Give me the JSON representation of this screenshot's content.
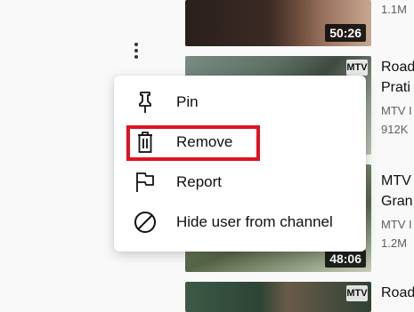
{
  "videos": [
    {
      "duration": "50:26",
      "title": "",
      "channel": "",
      "views": "1.1M",
      "badge": ""
    },
    {
      "duration": "",
      "title": "Road Prati",
      "channel": "MTV I",
      "views": "912K",
      "badge": "MTV"
    },
    {
      "duration": "48:06",
      "title": "MTV Gran",
      "channel": "MTV I",
      "views": "1.2M",
      "badge": "MTV"
    },
    {
      "duration": "",
      "title": "Road",
      "channel": "",
      "views": "",
      "badge": "MTV"
    }
  ],
  "menu": {
    "items": [
      {
        "label": "Pin",
        "icon": "pin-icon"
      },
      {
        "label": "Remove",
        "icon": "trash-icon"
      },
      {
        "label": "Report",
        "icon": "flag-icon"
      },
      {
        "label": "Hide user from channel",
        "icon": "block-icon"
      }
    ],
    "highlight_color": "#e0121f"
  }
}
